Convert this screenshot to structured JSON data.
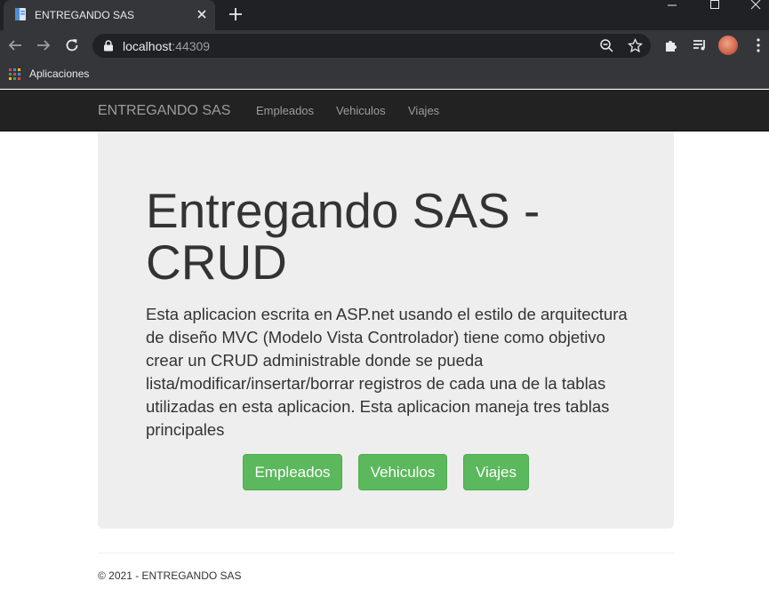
{
  "browser": {
    "tab_title": "ENTREGANDO SAS",
    "url_host": "localhost",
    "url_port": ":44309",
    "bookmark_apps_label": "Aplicaciones"
  },
  "navbar": {
    "brand": "ENTREGANDO SAS",
    "links": [
      "Empleados",
      "Vehiculos",
      "Viajes"
    ],
    "background": "#222222",
    "link_color": "#9d9d9d"
  },
  "jumbotron": {
    "title": "Entregando SAS - CRUD",
    "text": "Esta aplicacion escrita en ASP.net usando el estilo de arquitectura de diseño MVC (Modelo Vista Controlador) tiene como objetivo crear un CRUD administrable donde se pueda lista/modificar/insertar/borrar registros de cada una de la tablas utilizadas en esta aplicacion. Esta aplicacion maneja tres tablas principales",
    "buttons": [
      "Empleados",
      "Vehiculos",
      "Viajes"
    ],
    "background": "#eeeeee",
    "button_color": "#5cb85c"
  },
  "footer": {
    "text": "© 2021 - ENTREGANDO SAS"
  }
}
